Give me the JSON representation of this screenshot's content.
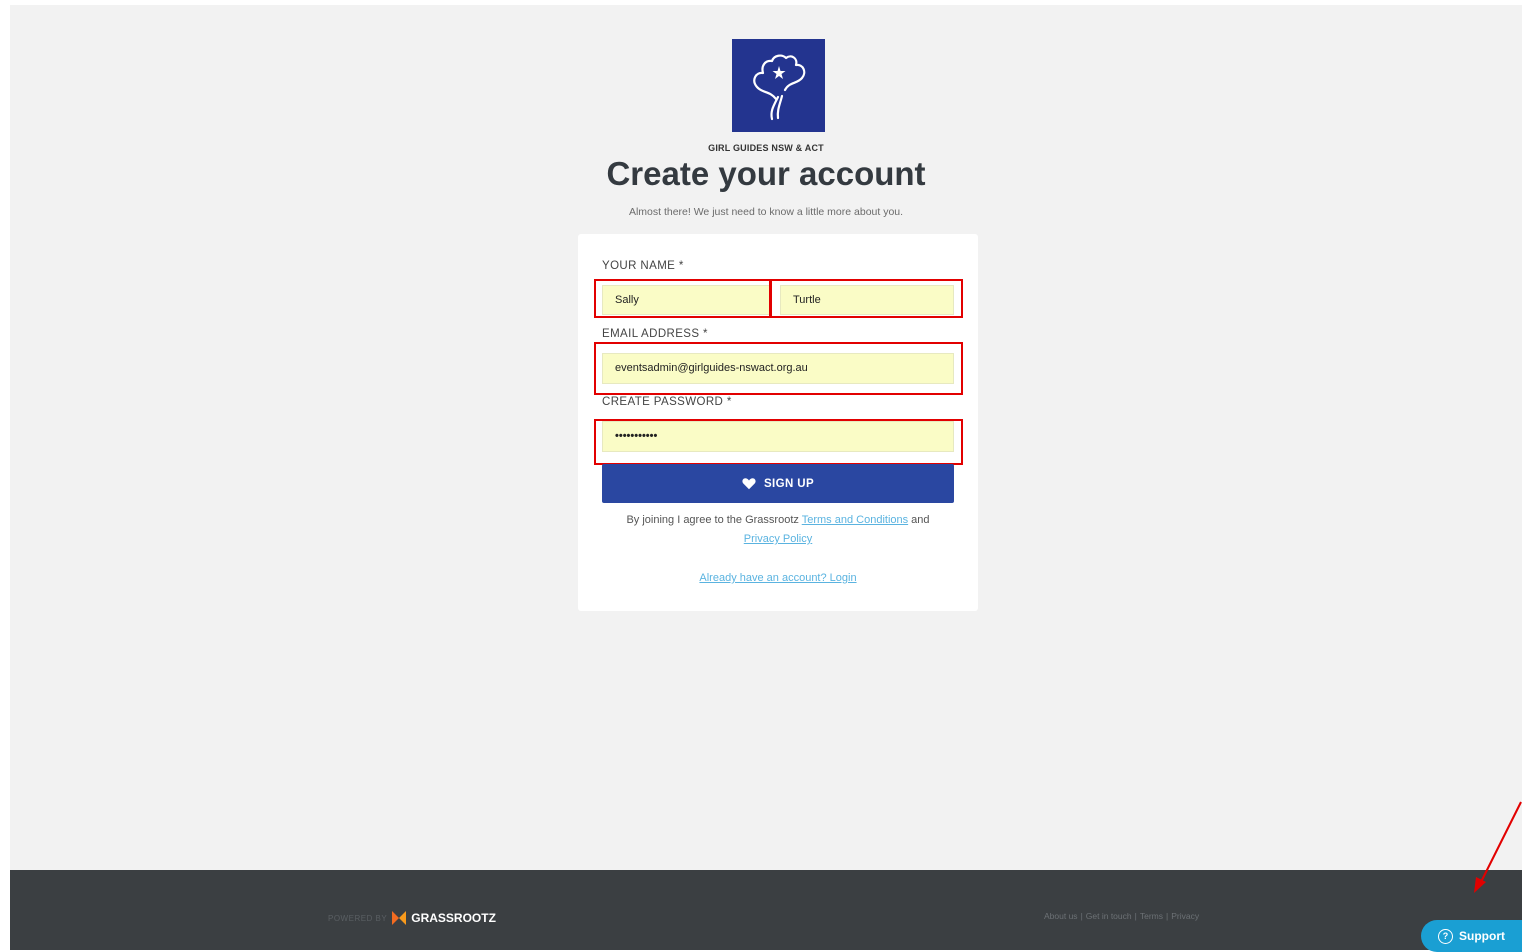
{
  "header": {
    "org_name": "GIRL GUIDES NSW & ACT",
    "title": "Create your account",
    "subtitle": "Almost there! We just need to know a little more about you."
  },
  "form": {
    "name_label": "YOUR NAME *",
    "first_name_value": "Sally",
    "last_name_value": "Turtle",
    "email_label": "EMAIL ADDRESS *",
    "email_value": "eventsadmin@girlguides-nswact.org.au",
    "password_label": "CREATE PASSWORD *",
    "password_value": "•••••••••••",
    "signup_label": "SIGN UP",
    "terms_prefix": "By joining I agree to the Grassrootz ",
    "terms_link": "Terms and Conditions",
    "terms_and": " and",
    "privacy_link": "Privacy Policy",
    "login_link": "Already have an account? Login"
  },
  "footer": {
    "powered_by": "POWERED BY",
    "brand": "GRASSROOTZ",
    "links": [
      "About us",
      "Get in touch",
      "Terms",
      "Privacy"
    ]
  },
  "support": {
    "label": "Support",
    "icon": "question-circle-icon"
  },
  "colors": {
    "page_bg": "#f2f2f2",
    "logo_bg": "#23348f",
    "button_bg": "#2a47a1",
    "autofill_bg": "#fafcc6",
    "link": "#5ab3e0",
    "footer_bg": "#3b3f42",
    "support_bg": "#1a9fd3",
    "highlight": "#e20000"
  }
}
